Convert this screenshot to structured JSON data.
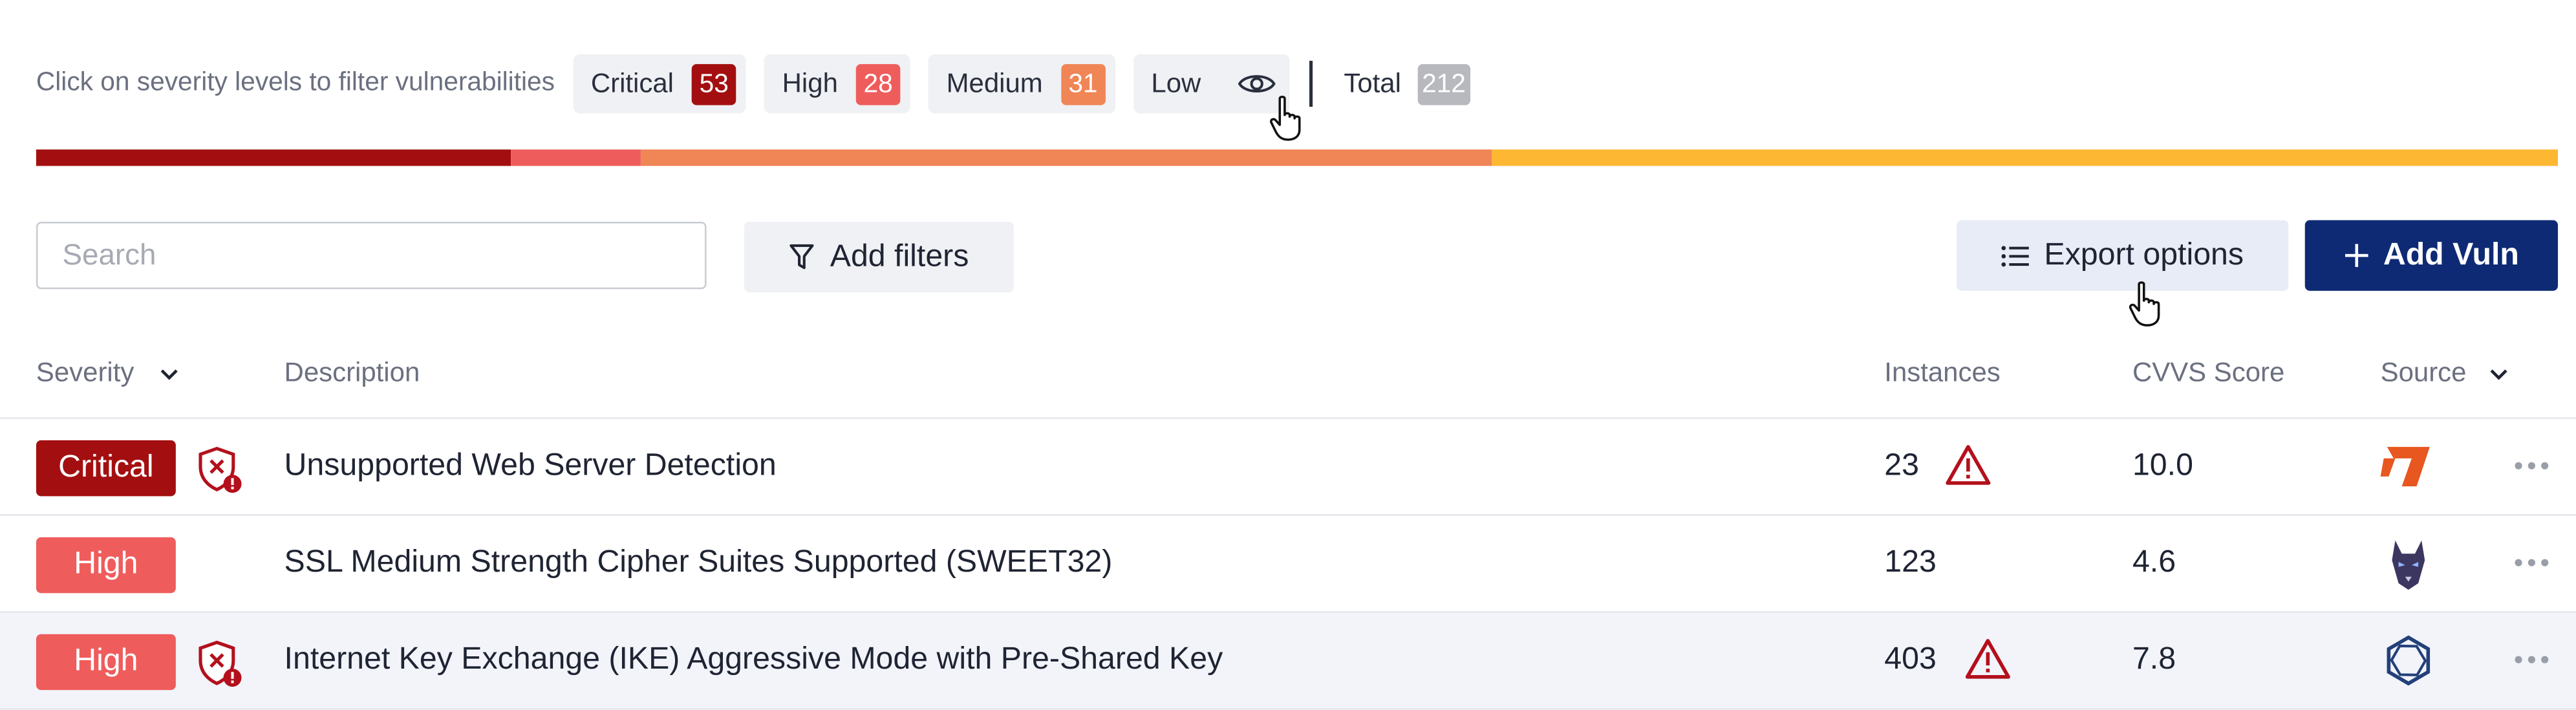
{
  "filter": {
    "hint": "Click on severity levels to filter vulnerabilities",
    "critical": {
      "label": "Critical",
      "count": "53"
    },
    "high": {
      "label": "High",
      "count": "28"
    },
    "medium": {
      "label": "Medium",
      "count": "31"
    },
    "low": {
      "label": "Low",
      "icon": "eye-icon"
    },
    "total": {
      "label": "Total",
      "count": "212"
    }
  },
  "severity_distribution": [
    {
      "level": "Critical",
      "share": 0.188,
      "color": "#a30f10"
    },
    {
      "level": "High",
      "share": 0.052,
      "color": "#ef5c5c"
    },
    {
      "level": "Medium",
      "share": 0.337,
      "color": "#f08556"
    },
    {
      "level": "Low",
      "share": 0.423,
      "color": "#fdb733"
    }
  ],
  "colors": {
    "critical": "#a30f10",
    "high": "#ef5c5c",
    "medium": "#f08556",
    "low": "#fdb733",
    "total": "#b8b9be",
    "primary": "#0f2a74"
  },
  "toolbar": {
    "search_placeholder": "Search",
    "add_filters": "Add filters",
    "export_options": "Export options",
    "add_vuln": "Add Vuln"
  },
  "table": {
    "columns": {
      "severity": "Severity",
      "description": "Description",
      "instances": "Instances",
      "cvss": "CVVS Score",
      "source": "Source"
    },
    "rows": [
      {
        "severity": "Critical",
        "description": "Unsupported Web Server Detection",
        "instances": "23",
        "cvss": "10.0",
        "source_icon": "source-logo-orange-icon",
        "has_shield": true,
        "has_warning": true
      },
      {
        "severity": "High",
        "description": "SSL Medium Strength Cipher Suites Supported (SWEET32)",
        "instances": "123",
        "cvss": "4.6",
        "source_icon": "source-logo-dog-icon",
        "has_shield": false,
        "has_warning": false
      },
      {
        "severity": "High",
        "description": "Internet Key Exchange (IKE) Aggressive Mode with Pre-Shared Key",
        "instances": "403",
        "cvss": "7.8",
        "source_icon": "source-logo-hexagon-icon",
        "has_shield": true,
        "has_warning": true
      }
    ]
  }
}
